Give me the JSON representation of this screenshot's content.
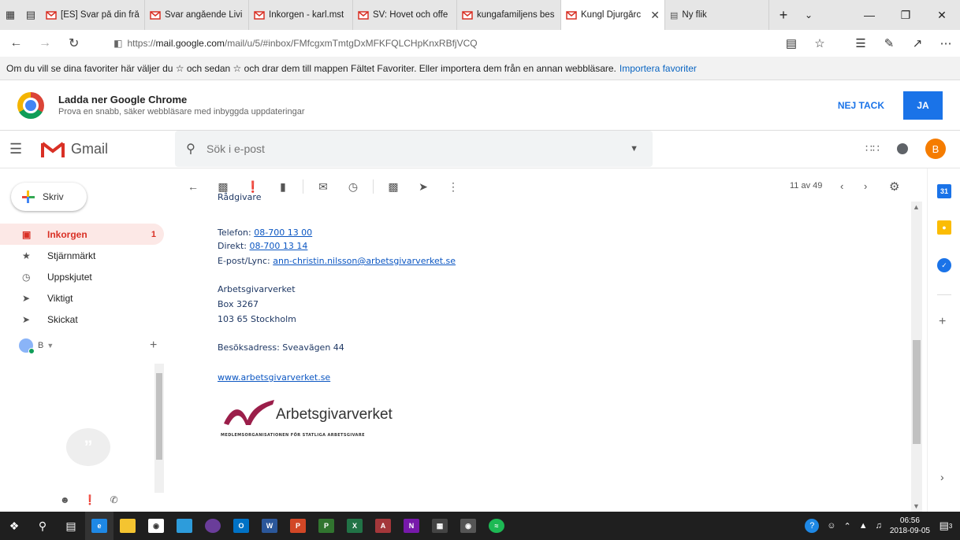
{
  "tabs": [
    {
      "label": "[ES] Svar på din frå",
      "icon": "gmail-icon",
      "active": false
    },
    {
      "label": "Svar angående Livi",
      "icon": "gmail-icon",
      "active": false
    },
    {
      "label": "Inkorgen - karl.mst",
      "icon": "gmail-icon",
      "active": false
    },
    {
      "label": "SV: Hovet och offe",
      "icon": "gmail-icon",
      "active": false
    },
    {
      "label": "kungafamiljens bes",
      "icon": "gmail-icon",
      "active": false
    },
    {
      "label": "Kungl Djurgårc",
      "icon": "gmail-icon",
      "active": true
    },
    {
      "label": "Ny flik",
      "icon": "newtab-icon",
      "active": false
    }
  ],
  "address": {
    "prefix": "https://",
    "domain": "mail.google.com",
    "path": "/mail/u/5/#inbox/FMfcgxmTmtgDxMFKFQLCHpKnxRBfjVCQ"
  },
  "favbar": {
    "text": "Om du vill se dina favoriter här väljer du ☆ och sedan ☆ och drar dem till mappen Fältet Favoriter. Eller importera dem från en annan webbläsare.",
    "link": "Importera favoriter"
  },
  "promo": {
    "title": "Ladda ner Google Chrome",
    "subtitle": "Prova en snabb, säker webbläsare med inbyggda uppdateringar",
    "no_label": "NEJ TACK",
    "yes_label": "JA"
  },
  "gmail": {
    "logo_text": "Gmail",
    "search_placeholder": "Sök i e-post",
    "avatar_letter": "B"
  },
  "nav": {
    "compose_label": "Skriv",
    "items": [
      {
        "label": "Inkorgen",
        "count": "1",
        "icon": "inbox-icon",
        "active": true
      },
      {
        "label": "Stjärnmärkt",
        "count": "",
        "icon": "star-icon",
        "active": false
      },
      {
        "label": "Uppskjutet",
        "count": "",
        "icon": "clock-icon",
        "active": false
      },
      {
        "label": "Viktigt",
        "count": "",
        "icon": "important-icon",
        "active": false
      },
      {
        "label": "Skickat",
        "count": "",
        "icon": "send-icon",
        "active": false
      }
    ],
    "hangouts_user": "B"
  },
  "toolbar": {
    "pager": "11 av 49"
  },
  "mail": {
    "role_fragment": "Rådgivare",
    "phone_label": "Telefon:",
    "phone": "08-700 13 00",
    "direct_label": "Direkt:",
    "direct": "08-700 13 14",
    "email_label": "E-post/Lync:",
    "email": "ann-christin.nilsson@arbetsgivarverket.se",
    "org": "Arbetsgivarverket",
    "box": "Box 3267",
    "city": "103 65 Stockholm",
    "visit": "Besöksadress: Sveavägen 44",
    "web": "www.arbetsgivarverket.se",
    "logo_word": "Arbetsgivarverket",
    "logo_sub": "MEDLEMSORGANISATIONEN FÖR STATLIGA ARBETSGIVARE"
  },
  "taskbar": {
    "time": "06:56",
    "date": "2018-09-05",
    "notifications": "3"
  }
}
